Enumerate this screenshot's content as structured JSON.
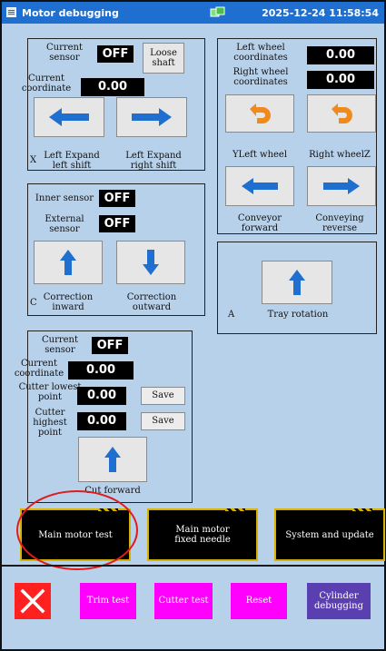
{
  "titlebar": {
    "title": "Motor debugging",
    "datetime": "2025-12-24 11:58:54"
  },
  "panel_shaft": {
    "current_sensor_label": "Current\nsensor",
    "current_sensor_value": "OFF",
    "loose_shaft_label": "Loose\nshaft",
    "current_coord_label": "Current\ncoordinate",
    "current_coord_value": "0.00",
    "axis_label": "X",
    "left_expand_left_label": "Left Expand\nleft shift",
    "left_expand_right_label": "Left Expand\nright shift"
  },
  "panel_wheels": {
    "left_wheel_coord_label": "Left wheel\ncoordinates",
    "left_wheel_coord_value": "0.00",
    "right_wheel_coord_label": "Right wheel\ncoordinates",
    "right_wheel_coord_value": "0.00",
    "left_wheel_label": "YLeft wheel",
    "right_wheel_label": "Right wheelZ",
    "conveyor_forward_label": "Conveyor\nforward",
    "conveying_reverse_label": "Conveying\nreverse"
  },
  "panel_correction": {
    "inner_sensor_label": "Inner sensor",
    "inner_sensor_value": "OFF",
    "external_sensor_label": "External\nsensor",
    "external_sensor_value": "OFF",
    "axis_label": "C",
    "correction_inward_label": "Correction\ninward",
    "correction_outward_label": "Correction\noutward"
  },
  "panel_tray": {
    "axis_label": "A",
    "tray_rotation_label": "Tray rotation"
  },
  "panel_cutter": {
    "current_sensor_label": "Current\nsensor",
    "current_sensor_value": "OFF",
    "current_coord_label": "Current\ncoordinate",
    "current_coord_value": "0.00",
    "lowest_point_label": "Cutter lowest\npoint",
    "lowest_point_value": "0.00",
    "highest_point_label": "Cutter highest\npoint",
    "highest_point_value": "0.00",
    "save_label": "Save",
    "cut_forward_label": "Cut forward"
  },
  "main_buttons": {
    "main_motor_test": "Main motor test",
    "main_motor_fixed_needle": "Main motor\nfixed needle",
    "system_and_update": "System and update"
  },
  "bottom_bar": {
    "trim_test": "Trim test",
    "cutter_test": "Cutter test",
    "reset": "Reset",
    "cylinder_debugging": "Cylinder\ndebugging"
  },
  "colors": {
    "background": "#b8d1ea",
    "titlebar": "#1f6fd1",
    "arrow_blue": "#1f6fd1",
    "arrow_orange": "#f08a1c",
    "magenta": "#ff00ff",
    "purple": "#5a3fb0",
    "close_red": "#ff2020",
    "highlight_ring": "#e01b1b"
  },
  "icons": [
    "app-menu-icon",
    "network-icon",
    "left-arrow-icon",
    "right-arrow-icon",
    "up-arrow-icon",
    "down-arrow-icon",
    "return-arrow-icon",
    "close-icon"
  ]
}
